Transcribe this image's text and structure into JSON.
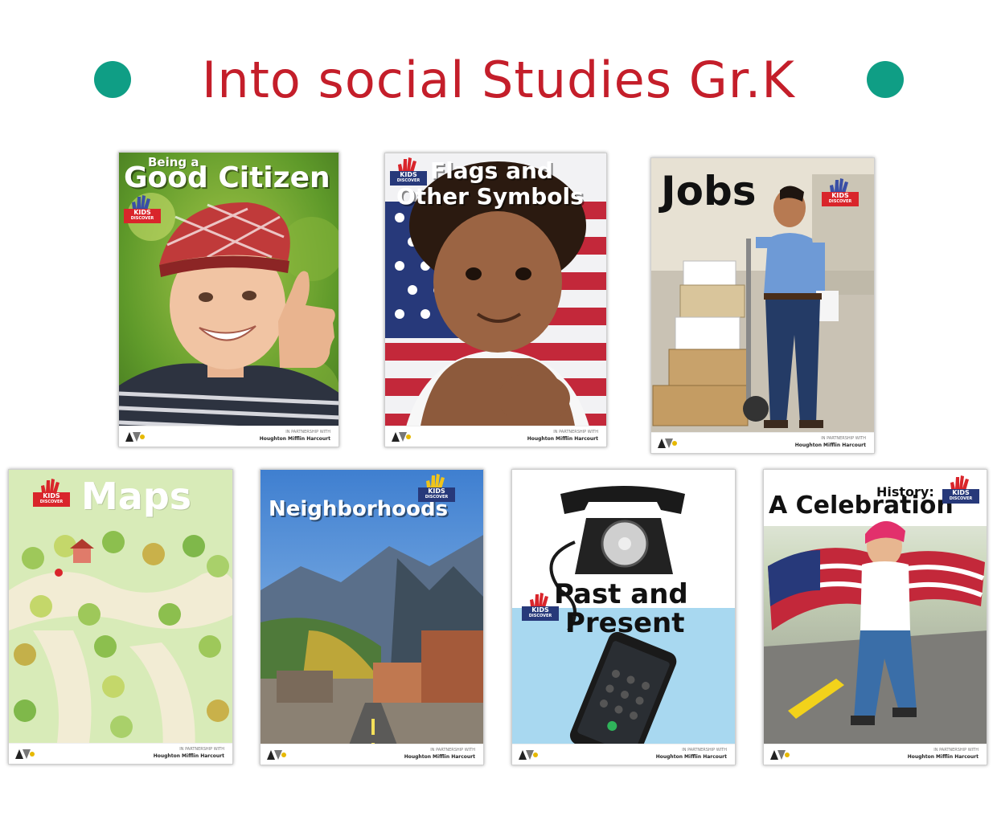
{
  "page": {
    "title": "Into social Studies Gr.K",
    "title_color": "#c41e2a",
    "dot_color": "#0f9e85"
  },
  "badge": {
    "brand_top": "KIDS",
    "brand_bottom": "DISCOVER",
    "icon": "hand-icon"
  },
  "publisher": {
    "line1": "IN PARTNERSHIP WITH",
    "line2": "Houghton Mifflin Harcourt",
    "icon": "publisher-logo-icon"
  },
  "books": [
    {
      "id": "good-citizen",
      "title_small": "Being a",
      "title": "Good Citizen"
    },
    {
      "id": "flags",
      "title_line1": "Flags and",
      "title_line2": "Other Symbols"
    },
    {
      "id": "jobs",
      "title": "Jobs"
    },
    {
      "id": "maps",
      "title": "Maps"
    },
    {
      "id": "neighborhoods",
      "title": "Neighborhoods"
    },
    {
      "id": "past-present",
      "title_line1": "Past and",
      "title_line2": "Present"
    },
    {
      "id": "history",
      "title_small": "History:",
      "title": "A Celebration"
    }
  ]
}
